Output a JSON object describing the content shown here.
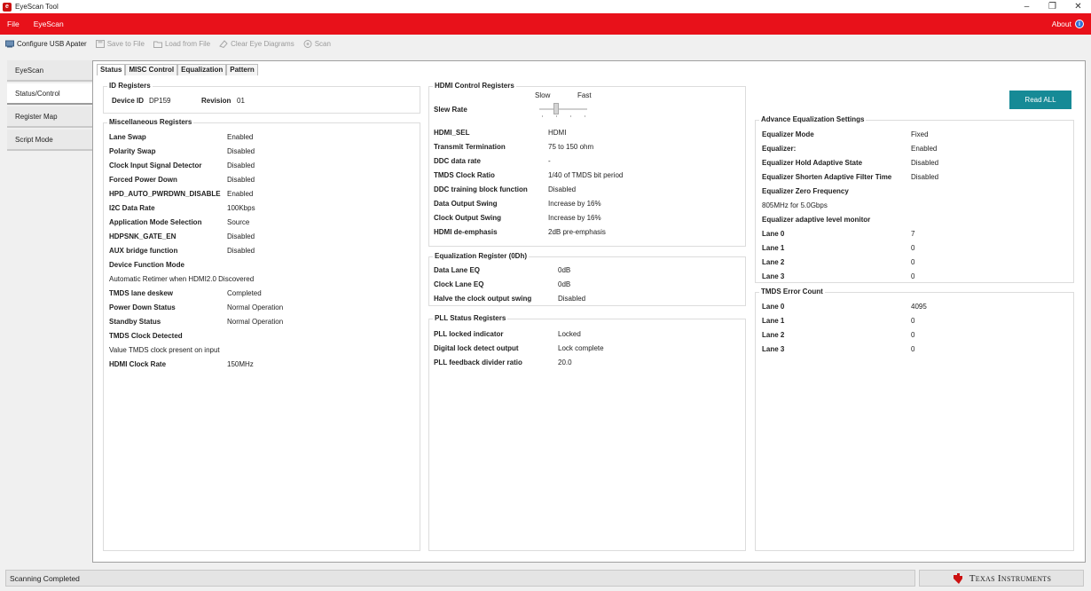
{
  "window": {
    "title": "EyeScan Tool"
  },
  "menubar": {
    "file": "File",
    "eyescan": "EyeScan",
    "about": "About"
  },
  "toolbar": {
    "configure": "Configure USB Apater",
    "save": "Save to File",
    "load": "Load from File",
    "clear": "Clear Eye Diagrams",
    "scan": "Scan"
  },
  "nav": [
    "EyeScan",
    "Status/Control",
    "Register Map",
    "Script Mode"
  ],
  "subtabs": [
    "Status",
    "MISC Control",
    "Equalization",
    "Pattern"
  ],
  "id_registers": {
    "title": "ID Registers",
    "device_id_label": "Device ID",
    "device_id_value": "DP159",
    "revision_label": "Revision",
    "revision_value": "01"
  },
  "misc_registers": {
    "title": "Miscellaneous Registers",
    "rows": [
      {
        "label": "Lane Swap",
        "value": "Enabled"
      },
      {
        "label": "Polarity Swap",
        "value": "Disabled"
      },
      {
        "label": "Clock Input Signal Detector",
        "value": "Disabled"
      },
      {
        "label": "Forced Power Down",
        "value": "Disabled"
      },
      {
        "label": "HPD_AUTO_PWRDWN_DISABLE",
        "value": "Enabled"
      },
      {
        "label": "I2C Data Rate",
        "value": "100Kbps"
      },
      {
        "label": "Application Mode Selection",
        "value": "Source"
      },
      {
        "label": "HDPSNK_GATE_EN",
        "value": "Disabled"
      },
      {
        "label": "AUX bridge function",
        "value": "Disabled"
      },
      {
        "label": "Device Function Mode",
        "value": ""
      },
      {
        "text": "Automatic Retimer when HDMI2.0 Discovered"
      },
      {
        "label": "TMDS lane deskew",
        "value": "Completed"
      },
      {
        "label": "Power Down Status",
        "value": "Normal Operation"
      },
      {
        "label": "Standby Status",
        "value": "Normal Operation"
      },
      {
        "label": "TMDS Clock Detected",
        "value": ""
      },
      {
        "text": "Value TMDS clock present on input"
      },
      {
        "label": "HDMI Clock Rate",
        "value": "150MHz"
      }
    ]
  },
  "hdmi_control": {
    "title": "HDMI Control Registers",
    "slow": "Slow",
    "fast": "Fast",
    "slew_rate": "Slew Rate",
    "rows": [
      {
        "label": "HDMI_SEL",
        "value": "HDMI"
      },
      {
        "label": "Transmit Termination",
        "value": "75 to 150 ohm"
      },
      {
        "label": "DDC data rate",
        "value": "-"
      },
      {
        "label": "TMDS Clock Ratio",
        "value": "1/40 of TMDS bit period"
      },
      {
        "label": "DDC training block function",
        "value": "Disabled"
      },
      {
        "label": "Data Output Swing",
        "value": "Increase by 16%"
      },
      {
        "label": "Clock Output Swing",
        "value": "Increase by 16%"
      },
      {
        "label": "HDMI de-emphasis",
        "value": "2dB pre-emphasis"
      }
    ]
  },
  "eq_register": {
    "title": "Equalization Register (0Dh)",
    "rows": [
      {
        "label": "Data Lane EQ",
        "value": "0dB"
      },
      {
        "label": "Clock Lane EQ",
        "value": "0dB"
      },
      {
        "label": "Halve the clock output swing",
        "value": "Disabled"
      }
    ]
  },
  "pll_status": {
    "title": "PLL Status Registers",
    "rows": [
      {
        "label": "PLL locked indicator",
        "value": "Locked"
      },
      {
        "label": "Digital lock detect output",
        "value": "Lock complete"
      },
      {
        "label": "PLL feedback divider ratio",
        "value": "20.0"
      }
    ]
  },
  "read_all": "Read ALL",
  "adv_eq": {
    "title": "Advance  Equalization Settings",
    "rows": [
      {
        "label": "Equalizer Mode",
        "value": "Fixed"
      },
      {
        "label": "Equalizer:",
        "value": "Enabled"
      },
      {
        "label": "Equalizer Hold Adaptive State",
        "value": "Disabled"
      },
      {
        "label": "Equalizer Shorten Adaptive Filter Time",
        "value": "Disabled"
      },
      {
        "label": "Equalizer Zero Frequency",
        "value": ""
      },
      {
        "text": "805MHz for 5.0Gbps"
      },
      {
        "label": "Equalizer adaptive level monitor",
        "value": ""
      },
      {
        "label": "Lane 0",
        "value": "7"
      },
      {
        "label": "Lane 1",
        "value": "0"
      },
      {
        "label": "Lane 2",
        "value": "0"
      },
      {
        "label": "Lane 3",
        "value": "0"
      }
    ]
  },
  "tmds_error": {
    "title": "TMDS Error Count",
    "rows": [
      {
        "label": "Lane 0",
        "value": "4095"
      },
      {
        "label": "Lane 1",
        "value": "0"
      },
      {
        "label": "Lane 2",
        "value": "0"
      },
      {
        "label": "Lane 3",
        "value": "0"
      }
    ]
  },
  "status": {
    "text": "Scanning Completed"
  },
  "brand": {
    "name": "Texas Instruments"
  },
  "colors": {
    "menubar": "#e8111a",
    "button": "#168a96"
  }
}
